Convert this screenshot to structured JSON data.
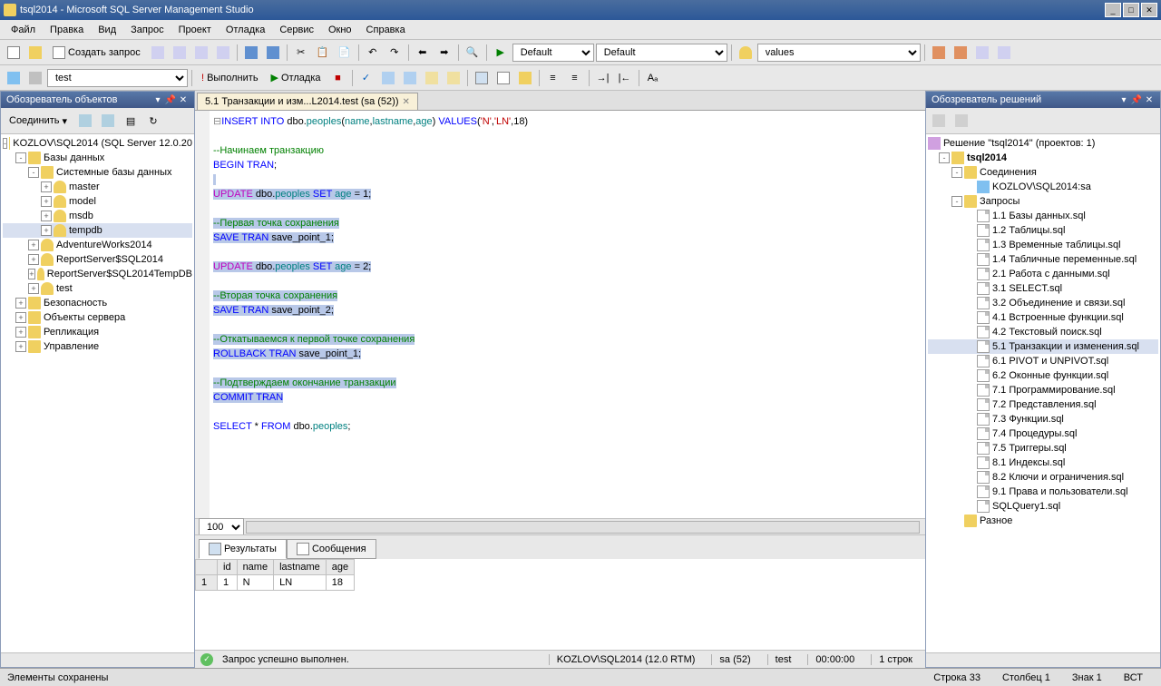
{
  "title": "tsql2014 - Microsoft SQL Server Management Studio",
  "menu": [
    "Файл",
    "Правка",
    "Вид",
    "Запрос",
    "Проект",
    "Отладка",
    "Сервис",
    "Окно",
    "Справка"
  ],
  "toolbar1": {
    "new_query": "Создать запрос",
    "combo1": "Default",
    "combo2": "Default",
    "combo3": "values"
  },
  "toolbar2": {
    "db_combo": "test",
    "execute": "Выполнить",
    "debug": "Отладка"
  },
  "object_explorer": {
    "title": "Обозреватель объектов",
    "connect": "Соединить",
    "server": "KOZLOV\\SQL2014 (SQL Server 12.0.20",
    "nodes": {
      "databases": "Базы данных",
      "system_db": "Системные базы данных",
      "master": "master",
      "model": "model",
      "msdb": "msdb",
      "tempdb": "tempdb",
      "aw": "AdventureWorks2014",
      "rs1": "ReportServer$SQL2014",
      "rs2": "ReportServer$SQL2014TempDB",
      "test": "test",
      "security": "Безопасность",
      "server_obj": "Объекты сервера",
      "replication": "Репликация",
      "management": "Управление"
    }
  },
  "tab": {
    "title": "5.1 Транзакции и изм...L2014.test (sa (52))"
  },
  "code": {
    "l1a": "INSERT INTO",
    "l1b": " dbo",
    "l1c": ".",
    "l1d": "peoples",
    "l1e": "(",
    "l1f": "name",
    "l1g": ",",
    "l1h": "lastname",
    "l1i": ",",
    "l1j": "age",
    "l1k": ") ",
    "l1l": "VALUES",
    "l1m": "(",
    "l1n": "'N'",
    "l1o": ",",
    "l1p": "'LN'",
    "l1q": ",18)",
    "l3": "--Начинаем транзакцию",
    "l4": "BEGIN TRAN",
    "l4b": ";",
    "l6a": "UPDATE",
    "l6b": " dbo",
    "l6c": ".",
    "l6d": "peoples",
    "l6e": " SET",
    "l6f": " age",
    "l6g": " = 1;",
    "l8": "--Первая точка сохранения",
    "l9a": "SAVE TRAN",
    "l9b": " save_point_1;",
    "l11a": "UPDATE",
    "l11b": " dbo",
    "l11c": ".",
    "l11d": "peoples",
    "l11e": " SET",
    "l11f": " age",
    "l11g": " = 2;",
    "l13": "--Вторая точка сохранения",
    "l14a": "SAVE TRAN",
    "l14b": " save_point_2;",
    "l16": "--Откатываемся к первой точке сохранения",
    "l17a": "ROLLBACK TRAN",
    "l17b": " save_point_1;",
    "l19": "--Подтверждаем окончание транзакции",
    "l20": "COMMIT TRAN",
    "l22a": "SELECT",
    "l22b": " * ",
    "l22c": "FROM",
    "l22d": " dbo",
    "l22e": ".",
    "l22f": "peoples",
    "l22g": ";"
  },
  "zoom": "100 %",
  "results": {
    "tab1": "Результаты",
    "tab2": "Сообщения",
    "headers": [
      "id",
      "name",
      "lastname",
      "age"
    ],
    "rows": [
      {
        "num": "1",
        "id": "1",
        "name": "N",
        "lastname": "LN",
        "age": "18"
      }
    ]
  },
  "status": {
    "success": "Запрос успешно выполнен.",
    "server": "KOZLOV\\SQL2014 (12.0 RTM)",
    "user": "sa (52)",
    "db": "test",
    "time": "00:00:00",
    "rows": "1 строк"
  },
  "solution": {
    "title": "Обозреватель решений",
    "root": "Решение \"tsql2014\" (проектов: 1)",
    "project": "tsql2014",
    "connections": "Соединения",
    "conn1": "KOZLOV\\SQL2014:sa",
    "queries": "Запросы",
    "files": [
      "1.1 Базы данных.sql",
      "1.2 Таблицы.sql",
      "1.3 Временные таблицы.sql",
      "1.4 Табличные переменные.sql",
      "2.1 Работа с данными.sql",
      "3.1 SELECT.sql",
      "3.2 Объединение и связи.sql",
      "4.1 Встроенные функции.sql",
      "4.2 Текстовый поиск.sql",
      "5.1 Транзакции и изменения.sql",
      "6.1 PIVOT и UNPIVOT.sql",
      "6.2 Оконные функции.sql",
      "7.1 Программирование.sql",
      "7.2 Представления.sql",
      "7.3 Функции.sql",
      "7.4 Процедуры.sql",
      "7.5 Триггеры.sql",
      "8.1 Индексы.sql",
      "8.2 Ключи и ограничения.sql",
      "9.1 Права и пользователи.sql",
      "SQLQuery1.sql"
    ],
    "misc": "Разное"
  },
  "bottom_status": {
    "saved": "Элементы сохранены",
    "line": "Строка 33",
    "col": "Столбец 1",
    "char": "Знак 1",
    "ins": "ВСТ"
  }
}
